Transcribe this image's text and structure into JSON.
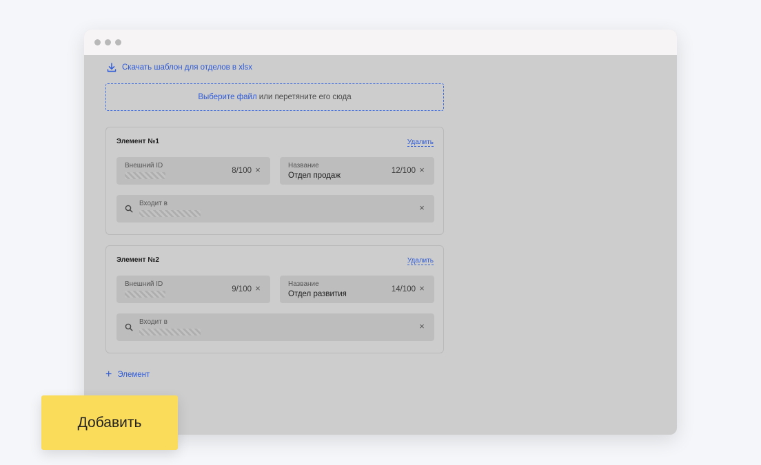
{
  "download": {
    "label": "Скачать шаблон для отделов в xlsx"
  },
  "dropzone": {
    "pick_label": "Выберите файл",
    "rest_label": "или перетяните его сюда"
  },
  "elements": [
    {
      "title": "Элемент №1",
      "delete_label": "Удалить",
      "external_id": {
        "label": "Внешний ID",
        "counter": "8/100"
      },
      "name": {
        "label": "Название",
        "value": "Отдел продаж",
        "counter": "12/100"
      },
      "parent": {
        "label": "Входит в"
      }
    },
    {
      "title": "Элемент №2",
      "delete_label": "Удалить",
      "external_id": {
        "label": "Внешний ID",
        "counter": "9/100"
      },
      "name": {
        "label": "Название",
        "value": "Отдел развития",
        "counter": "14/100"
      },
      "parent": {
        "label": "Входит в"
      }
    }
  ],
  "add_element": {
    "label": "Элемент"
  },
  "add_button": {
    "label": "Добавить"
  },
  "icons": {
    "clear": "×"
  },
  "colors": {
    "accent": "#2f5bd8",
    "button": "#fbdb5a"
  }
}
